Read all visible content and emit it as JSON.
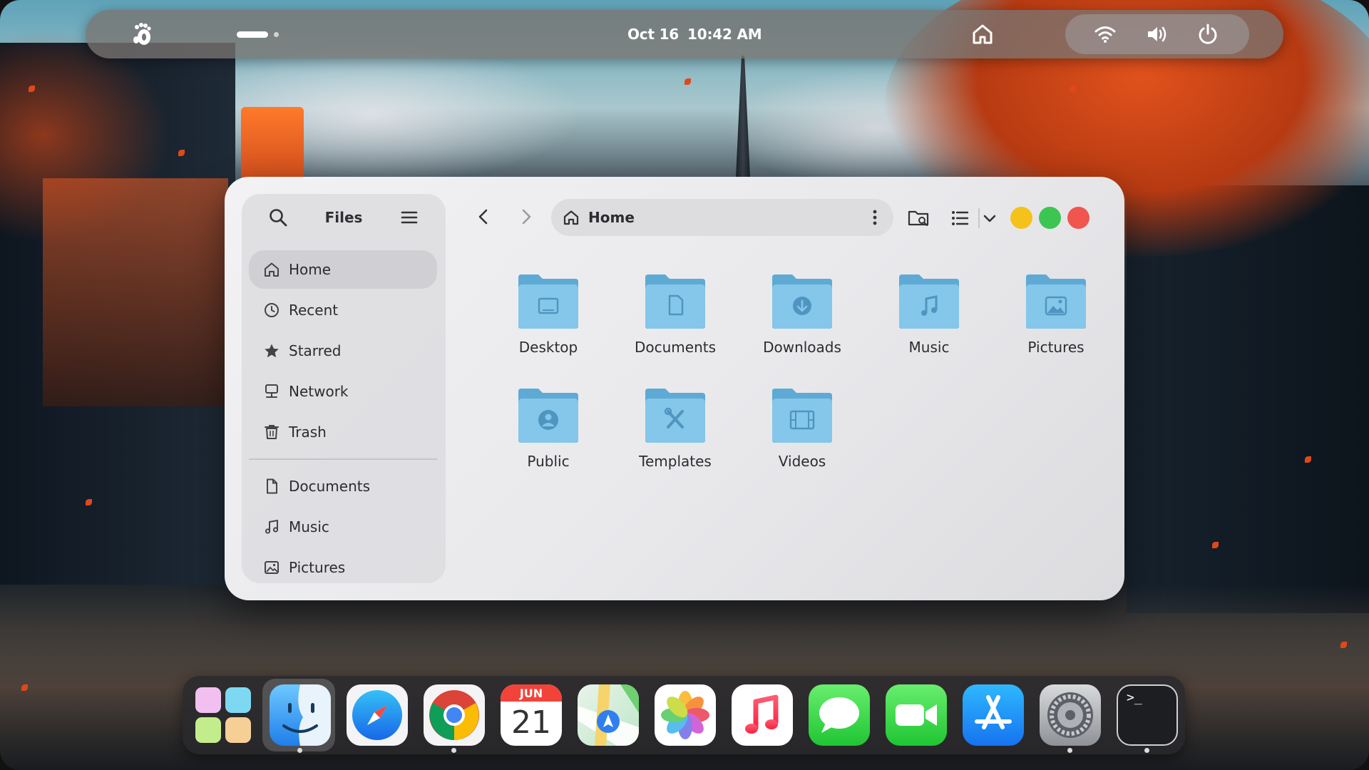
{
  "topbar": {
    "logo": "gnome-foot-icon",
    "date": "Oct 16",
    "time": "10:42 AM",
    "tray_icons": [
      "home-icon",
      "wifi-icon",
      "volume-icon",
      "power-icon"
    ]
  },
  "window": {
    "sidebar": {
      "title": "Files",
      "places": [
        {
          "label": "Home",
          "icon": "home-icon",
          "active": true
        },
        {
          "label": "Recent",
          "icon": "clock-icon"
        },
        {
          "label": "Starred",
          "icon": "star-icon"
        },
        {
          "label": "Network",
          "icon": "network-icon"
        },
        {
          "label": "Trash",
          "icon": "trash-icon"
        }
      ],
      "bookmarks": [
        {
          "label": "Documents",
          "icon": "document-icon"
        },
        {
          "label": "Music",
          "icon": "music-icon"
        },
        {
          "label": "Pictures",
          "icon": "picture-icon"
        }
      ]
    },
    "header": {
      "location": "Home",
      "window_controls": {
        "minimize": "#f5c21b",
        "maximize": "#3cc552",
        "close": "#f0564e"
      }
    },
    "folders": [
      {
        "label": "Desktop",
        "icon": "desktop-icon"
      },
      {
        "label": "Documents",
        "icon": "document-icon"
      },
      {
        "label": "Downloads",
        "icon": "download-icon"
      },
      {
        "label": "Music",
        "icon": "music-icon"
      },
      {
        "label": "Pictures",
        "icon": "picture-icon"
      },
      {
        "label": "Public",
        "icon": "user-icon"
      },
      {
        "label": "Templates",
        "icon": "tools-icon"
      },
      {
        "label": "Videos",
        "icon": "film-icon"
      }
    ],
    "folder_color": "#7cc3e8"
  },
  "dock": {
    "apps": [
      {
        "name": "launchpad",
        "running": false
      },
      {
        "name": "finder",
        "running": true,
        "selected": true
      },
      {
        "name": "safari",
        "running": false
      },
      {
        "name": "chrome",
        "running": true
      },
      {
        "name": "calendar",
        "running": false,
        "month": "JUN",
        "day": "21"
      },
      {
        "name": "maps",
        "running": false
      },
      {
        "name": "photos",
        "running": false
      },
      {
        "name": "music",
        "running": false
      },
      {
        "name": "messages",
        "running": false
      },
      {
        "name": "facetime",
        "running": false
      },
      {
        "name": "app-store",
        "running": false
      },
      {
        "name": "system-settings",
        "running": true
      },
      {
        "name": "terminal",
        "running": true,
        "prompt": ">_"
      }
    ]
  }
}
